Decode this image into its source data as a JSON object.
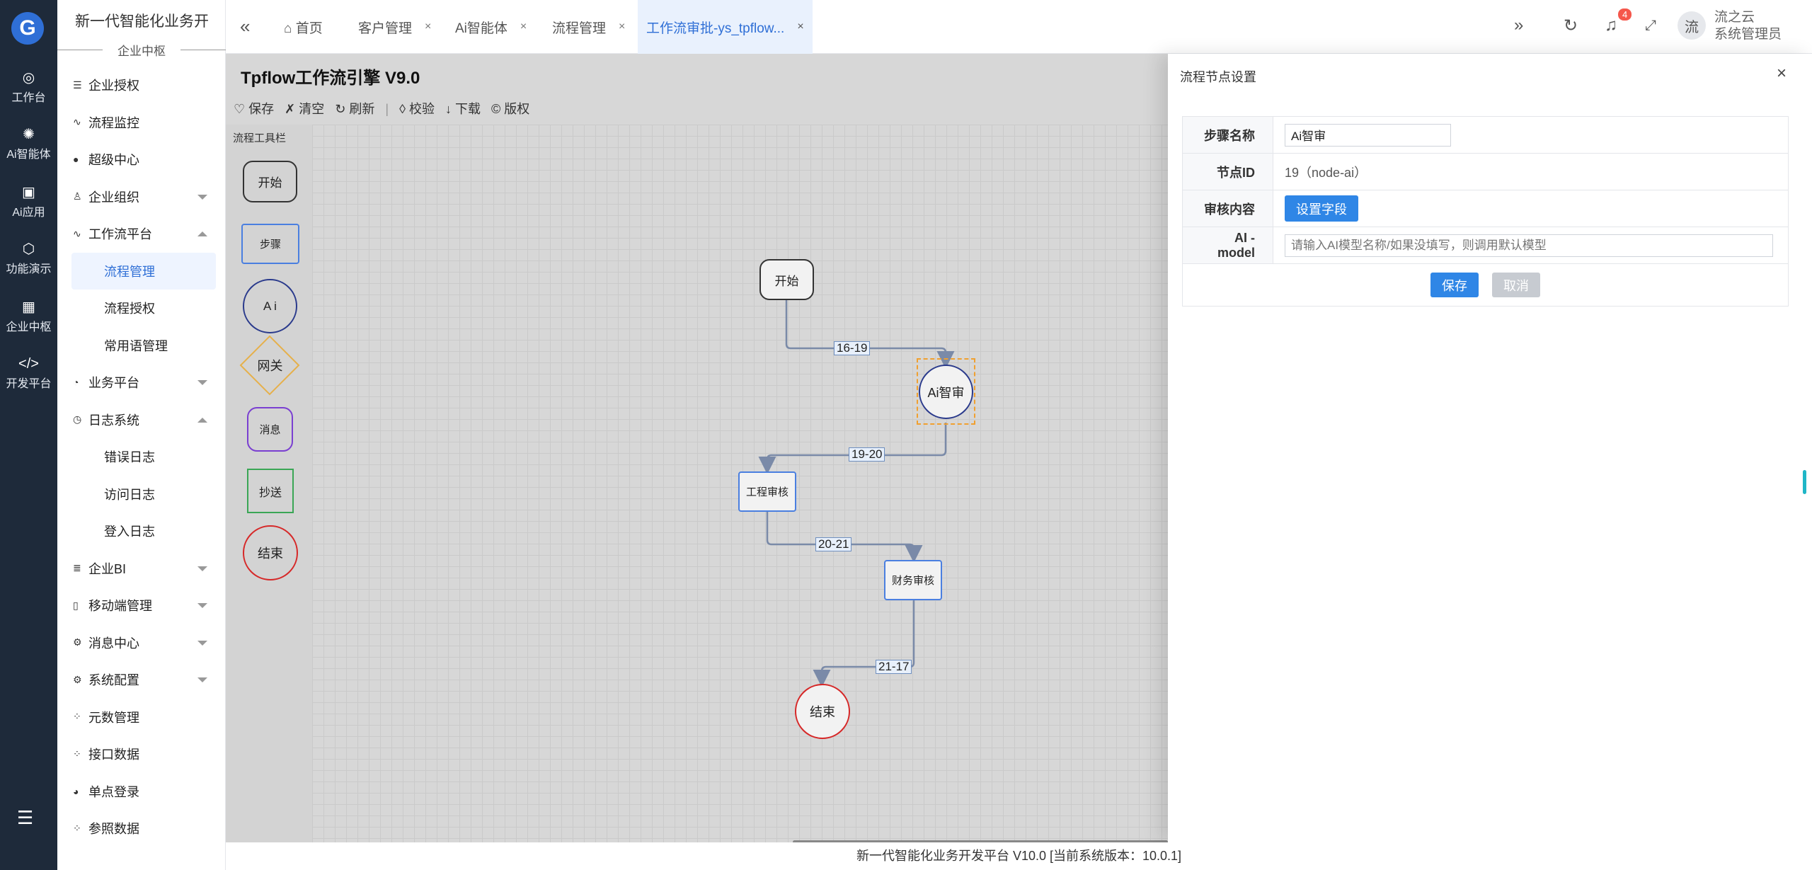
{
  "rail": {
    "items": [
      {
        "label": "工作台",
        "icon": "dashboard-icon",
        "glyph": "◎"
      },
      {
        "label": "Ai智能体",
        "icon": "ai-agent-icon",
        "glyph": "✺"
      },
      {
        "label": "Ai应用",
        "icon": "ai-app-icon",
        "glyph": "▣"
      },
      {
        "label": "功能演示",
        "icon": "cube-icon",
        "glyph": "⬡"
      },
      {
        "label": "企业中枢",
        "icon": "grid-icon",
        "glyph": "▦"
      },
      {
        "label": "开发平台",
        "icon": "code-icon",
        "glyph": "</>"
      }
    ],
    "menu_toggle": "☰"
  },
  "sidebar": {
    "brand": "新一代智能化业务开",
    "hub_label": "企业中枢",
    "items": [
      {
        "label": "企业授权",
        "icon": "sliders-icon",
        "glyph": "☰"
      },
      {
        "label": "流程监控",
        "icon": "pulse-icon",
        "glyph": "∿"
      },
      {
        "label": "超级中心",
        "icon": "fire-icon",
        "glyph": "●"
      },
      {
        "label": "企业组织",
        "icon": "user-icon",
        "glyph": "♙"
      },
      {
        "label": "工作流平台",
        "icon": "workflow-icon",
        "glyph": "∿"
      },
      {
        "label": "流程管理"
      },
      {
        "label": "流程授权"
      },
      {
        "label": "常用语管理"
      },
      {
        "label": "业务平台",
        "icon": "business-icon",
        "glyph": "◔"
      },
      {
        "label": "日志系统",
        "icon": "clock-icon",
        "glyph": "◷"
      },
      {
        "label": "错误日志"
      },
      {
        "label": "访问日志"
      },
      {
        "label": "登入日志"
      },
      {
        "label": "企业BI",
        "icon": "bi-icon",
        "glyph": "≣"
      },
      {
        "label": "移动端管理",
        "icon": "mobile-icon",
        "glyph": "▯"
      },
      {
        "label": "消息中心",
        "icon": "gear-icon",
        "glyph": "⚙"
      },
      {
        "label": "系统配置",
        "icon": "settings-icon",
        "glyph": "⚙"
      },
      {
        "label": "元数管理",
        "icon": "loading-icon",
        "glyph": "⁘"
      },
      {
        "label": "接口数据",
        "icon": "loading-icon",
        "glyph": "⁘"
      },
      {
        "label": "单点登录",
        "icon": "sso-icon",
        "glyph": "◕"
      },
      {
        "label": "参照数据",
        "icon": "loading-icon",
        "glyph": "⁘"
      }
    ]
  },
  "topbar": {
    "tabs": [
      {
        "label": "⌂ 首页"
      },
      {
        "label": "客户管理",
        "close": "×"
      },
      {
        "label": "Ai智能体",
        "close": "×"
      },
      {
        "label": "流程管理",
        "close": "×"
      },
      {
        "label": "工作流审批-ys_tpflow...",
        "close": "×"
      }
    ],
    "notification_count": "4",
    "avatar_char": "流",
    "user_company": "流之云",
    "user_role": "系统管理员"
  },
  "workflow": {
    "title": "Tpflow工作流引擎 V9.0",
    "toolbar": {
      "save": "♡ 保存",
      "clear": "✗ 清空",
      "refresh": "↻ 刷新",
      "sep": "|",
      "check": "◊ 校验",
      "download": "↓ 下载",
      "copyright": "© 版权"
    },
    "palette_title": "流程工具栏",
    "palette": {
      "start": "开始",
      "step": "步骤",
      "ai": "A i",
      "gateway": "网关",
      "message": "消息",
      "cc": "抄送",
      "end": "结束"
    },
    "nodes": {
      "start": "开始",
      "ai": "Ai智审",
      "eng": "工程审核",
      "fin": "财务审核",
      "end": "结束"
    },
    "edges": {
      "e1": "16-19",
      "e2": "19-20",
      "e3": "20-21",
      "e4": "21-17"
    },
    "colors": {
      "start_border": "#333333",
      "step_border": "#4a7fe0",
      "ai_border": "#2a3a8c",
      "gateway_border": "#e6b04a",
      "message_border": "#7a3fd1",
      "cc_border": "#3aa655",
      "end_border": "#d62828",
      "selected_border": "#f0a030"
    }
  },
  "panel": {
    "title": "流程节点设置",
    "close": "×",
    "rows": {
      "step_name_label": "步骤名称",
      "step_name_value": "Ai智审",
      "node_id_label": "节点ID",
      "node_id_value": "19（node-ai）",
      "review_label": "审核内容",
      "review_button": "设置字段",
      "model_label": "AI - model",
      "model_placeholder": "请输入AI模型名称/如果没填写，则调用默认模型"
    },
    "save_button": "保存",
    "cancel_button": "取消"
  },
  "footer": {
    "text": "新一代智能化业务开发平台 V10.0 [当前系统版本：10.0.1]"
  },
  "colors": {
    "rail_bg": "#1e2a3a",
    "accent": "#2f6fd6",
    "primary_button": "#2f86e6",
    "badge": "#f5574b"
  }
}
